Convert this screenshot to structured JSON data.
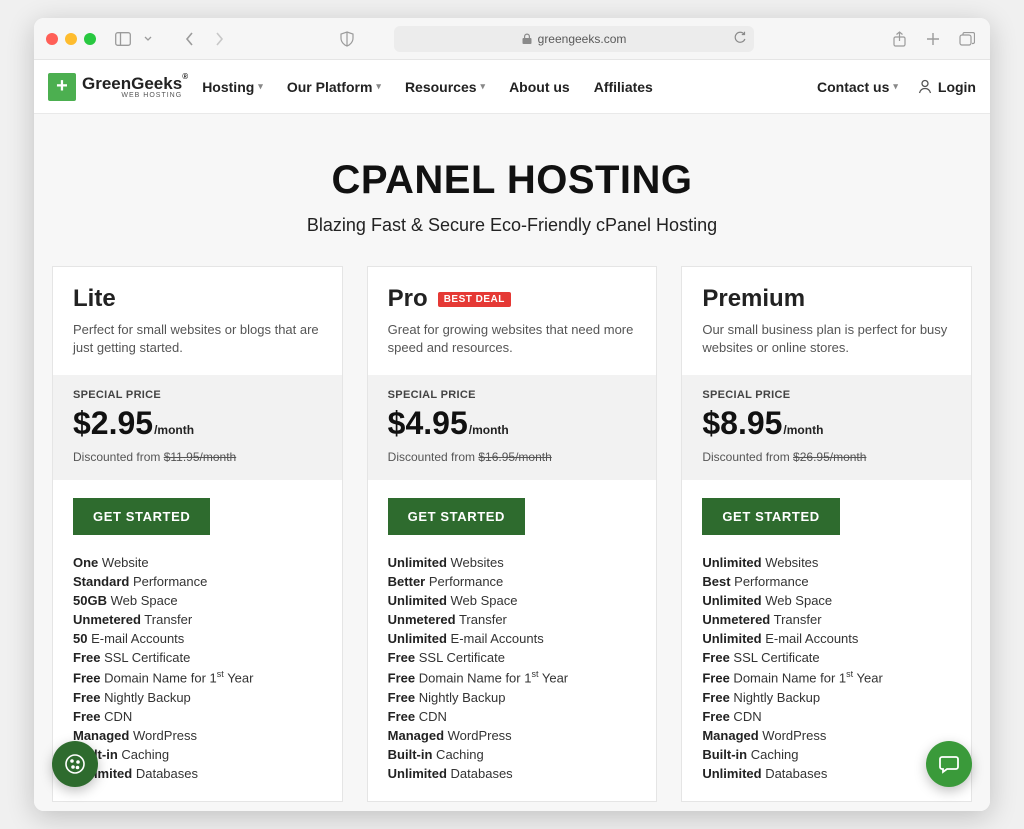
{
  "browser": {
    "url_host": "greengeeks.com"
  },
  "brand": {
    "name": "GreenGeeks",
    "tagline": "WEB HOSTING"
  },
  "nav": {
    "items": [
      {
        "label": "Hosting",
        "dropdown": true
      },
      {
        "label": "Our Platform",
        "dropdown": true
      },
      {
        "label": "Resources",
        "dropdown": true
      },
      {
        "label": "About us",
        "dropdown": false
      },
      {
        "label": "Affiliates",
        "dropdown": false
      }
    ],
    "contact": {
      "label": "Contact us",
      "dropdown": true
    },
    "login": "Login"
  },
  "hero": {
    "title": "CPANEL HOSTING",
    "subtitle": "Blazing Fast & Secure Eco-Friendly cPanel Hosting"
  },
  "special_price_label": "SPECIAL PRICE",
  "per_month": "/month",
  "cta_label": "GET STARTED",
  "best_deal_label": "BEST DEAL",
  "plans": [
    {
      "name": "Lite",
      "desc": "Perfect for small websites or blogs that are just getting started.",
      "price": "$2.95",
      "discounted_from_prefix": "Discounted from ",
      "discounted_from_value": "$11.95/month",
      "best_deal": false,
      "features": [
        {
          "bold": "One",
          "rest": " Website"
        },
        {
          "bold": "Standard",
          "rest": " Performance"
        },
        {
          "bold": "50GB",
          "rest": " Web Space"
        },
        {
          "bold": "Unmetered",
          "rest": " Transfer"
        },
        {
          "bold": "50",
          "rest": " E-mail Accounts"
        },
        {
          "bold": "Free",
          "rest": " SSL Certificate"
        },
        {
          "bold": "Free",
          "rest": " Domain Name for 1",
          "sup": "st",
          "after": " Year"
        },
        {
          "bold": "Free",
          "rest": " Nightly Backup"
        },
        {
          "bold": "Free",
          "rest": " CDN"
        },
        {
          "bold": "Managed",
          "rest": " WordPress"
        },
        {
          "bold": "Built-in",
          "rest": " Caching"
        },
        {
          "bold": "Unlimited",
          "rest": " Databases"
        }
      ]
    },
    {
      "name": "Pro",
      "desc": "Great for growing websites that need more speed and resources.",
      "price": "$4.95",
      "discounted_from_prefix": "Discounted from ",
      "discounted_from_value": "$16.95/month",
      "best_deal": true,
      "features": [
        {
          "bold": "Unlimited",
          "rest": " Websites"
        },
        {
          "bold": "Better",
          "rest": " Performance"
        },
        {
          "bold": "Unlimited",
          "rest": " Web Space"
        },
        {
          "bold": "Unmetered",
          "rest": " Transfer"
        },
        {
          "bold": "Unlimited",
          "rest": " E-mail Accounts"
        },
        {
          "bold": "Free",
          "rest": " SSL Certificate"
        },
        {
          "bold": "Free",
          "rest": " Domain Name for 1",
          "sup": "st",
          "after": " Year"
        },
        {
          "bold": "Free",
          "rest": " Nightly Backup"
        },
        {
          "bold": "Free",
          "rest": " CDN"
        },
        {
          "bold": "Managed",
          "rest": " WordPress"
        },
        {
          "bold": "Built-in",
          "rest": " Caching"
        },
        {
          "bold": "Unlimited",
          "rest": " Databases"
        }
      ]
    },
    {
      "name": "Premium",
      "desc": "Our small business plan is perfect for busy websites or online stores.",
      "price": "$8.95",
      "discounted_from_prefix": "Discounted from ",
      "discounted_from_value": "$26.95/month",
      "best_deal": false,
      "features": [
        {
          "bold": "Unlimited",
          "rest": " Websites"
        },
        {
          "bold": "Best",
          "rest": " Performance"
        },
        {
          "bold": "Unlimited",
          "rest": " Web Space"
        },
        {
          "bold": "Unmetered",
          "rest": " Transfer"
        },
        {
          "bold": "Unlimited",
          "rest": " E-mail Accounts"
        },
        {
          "bold": "Free",
          "rest": " SSL Certificate"
        },
        {
          "bold": "Free",
          "rest": " Domain Name for 1",
          "sup": "st",
          "after": " Year"
        },
        {
          "bold": "Free",
          "rest": " Nightly Backup"
        },
        {
          "bold": "Free",
          "rest": " CDN"
        },
        {
          "bold": "Managed",
          "rest": " WordPress"
        },
        {
          "bold": "Built-in",
          "rest": " Caching"
        },
        {
          "bold": "Unlimited",
          "rest": " Databases"
        }
      ]
    }
  ]
}
